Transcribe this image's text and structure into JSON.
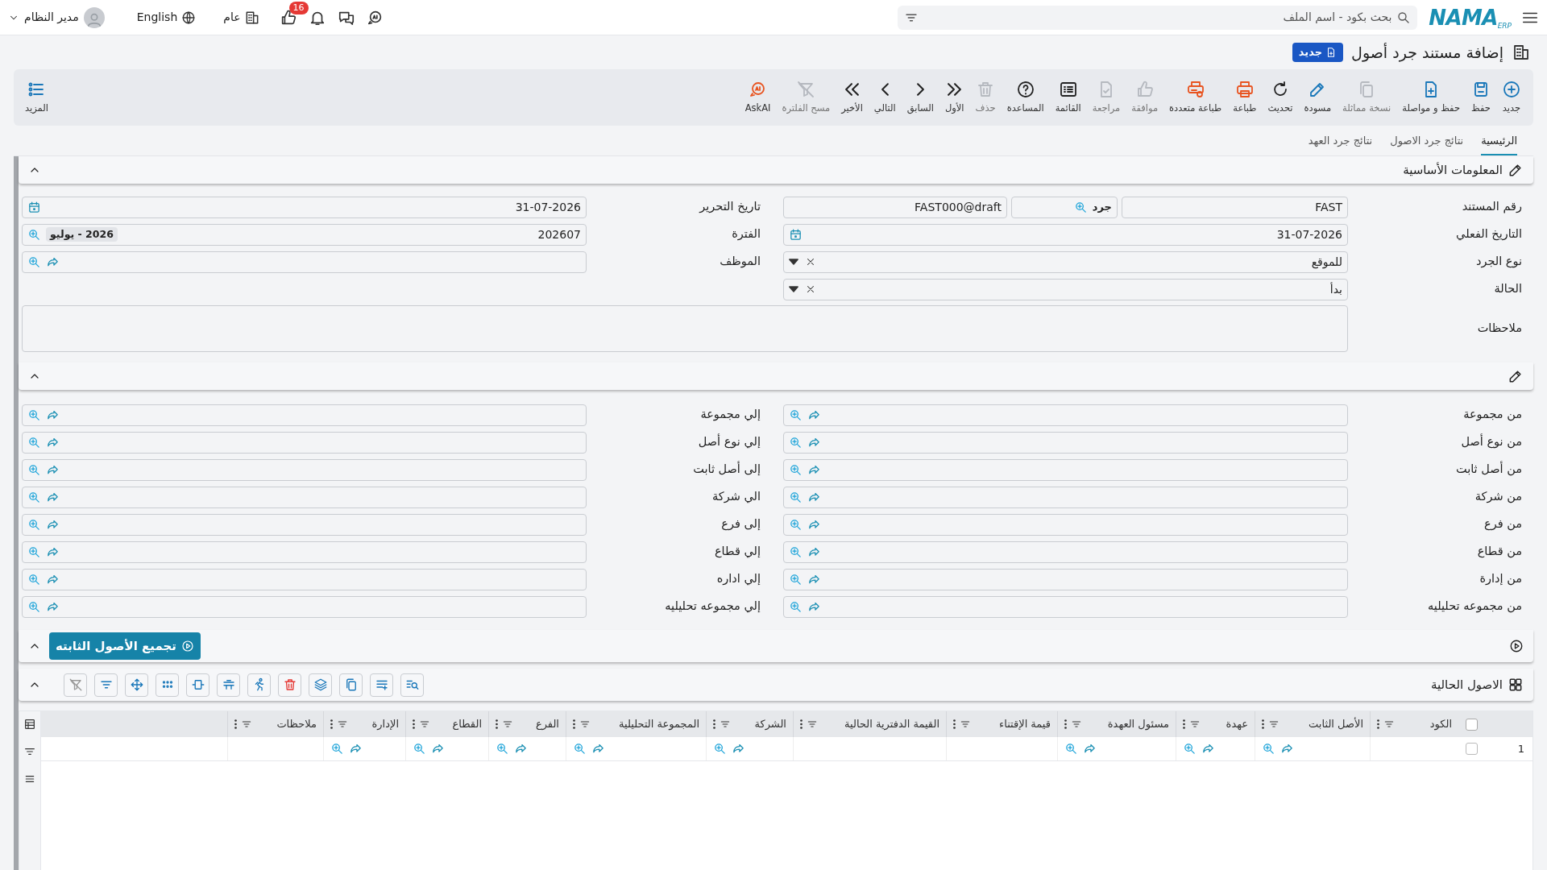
{
  "top_bar": {
    "logo": "NAMA",
    "logo_sub": "ERP",
    "search": {
      "placeholder": "بحث بكود - اسم الملف"
    },
    "user": "مدير النظام",
    "language": "English",
    "branch": "عام",
    "notifications_badge": "16"
  },
  "page": {
    "title": "إضافة مستند جرد أصول",
    "status_badge": "جديد"
  },
  "toolbar": [
    {
      "label": "جديد",
      "disabled": false
    },
    {
      "label": "حفظ",
      "disabled": false
    },
    {
      "label": "حفظ و مواصلة",
      "disabled": false
    },
    {
      "label": "نسخة مماثلة",
      "disabled": true
    },
    {
      "label": "مسودة",
      "disabled": false
    },
    {
      "label": "تحديث",
      "disabled": false
    },
    {
      "label": "طباعة",
      "disabled": false
    },
    {
      "label": "طباعة متعددة",
      "disabled": false
    },
    {
      "label": "موافقة",
      "disabled": true
    },
    {
      "label": "مراجعة",
      "disabled": true
    },
    {
      "label": "القائمة",
      "disabled": false
    },
    {
      "label": "المساعدة",
      "disabled": false
    },
    {
      "label": "حذف",
      "disabled": true
    },
    {
      "label": "الأول",
      "disabled": false
    },
    {
      "label": "السابق",
      "disabled": false
    },
    {
      "label": "التالي",
      "disabled": false
    },
    {
      "label": "الأخير",
      "disabled": false
    },
    {
      "label": "مسح الفلترة",
      "disabled": true
    },
    {
      "label": "AskAI",
      "disabled": false
    }
  ],
  "more_button": "المزيد",
  "tabs": [
    {
      "label": "الرئيسية",
      "selected": true
    },
    {
      "label": "نتائج جرد الاصول",
      "selected": false
    },
    {
      "label": "نتائج جرد العهد",
      "selected": false
    }
  ],
  "basic_info": {
    "title": "المعلومات الأساسية",
    "expanded": true,
    "fields": [
      {
        "kind": "document_number",
        "label": "رقم المستند",
        "value": "FAST",
        "tag": "جرد",
        "draft": "FAST000@draft"
      },
      {
        "kind": "date",
        "label": "تاريخ التحرير",
        "value": "31-07-2026"
      },
      {
        "kind": "date",
        "label": "التاريخ الفعلي",
        "value": "31-07-2026"
      },
      {
        "kind": "period",
        "label": "الفترة",
        "value": "202607",
        "chip": "2026 - يوليو"
      },
      {
        "kind": "select",
        "label": "نوع الجرد",
        "value": "للموقع"
      },
      {
        "kind": "lookup",
        "label": "الموظف"
      },
      {
        "kind": "select",
        "label": "الحالة",
        "value": "بدأ"
      }
    ],
    "notes_label": "ملاحظات"
  },
  "range_section": {
    "expanded": true,
    "fields": [
      {
        "label": "من مجموعة"
      },
      {
        "label": "إلي مجموعة"
      },
      {
        "label": "من نوع أصل"
      },
      {
        "label": "إلي نوع أصل"
      },
      {
        "label": "من أصل ثابت"
      },
      {
        "label": "إلى أصل ثابت"
      },
      {
        "label": "من شركة"
      },
      {
        "label": "الي شركة"
      },
      {
        "label": "من فرع"
      },
      {
        "label": "إلى فرع"
      },
      {
        "label": "من قطاع"
      },
      {
        "label": "إلي قطاع"
      },
      {
        "label": "من إدارة"
      },
      {
        "label": "إلي اداره"
      },
      {
        "label": "من مجموعه تحليليه"
      },
      {
        "label": "إلي مجموعه تحليليه"
      }
    ]
  },
  "collect_button": "تجميع الأصول الثابته",
  "assets_grid": {
    "title": "الاصول الحالية",
    "expanded": true,
    "select_all_checked": false,
    "columns": [
      "الكود",
      "الأصل الثابت",
      "عهدة",
      "مسئول العهدة",
      "قيمة الإقتناء",
      "القيمة الدفترية الحالية",
      "الشركة",
      "المجموعة التحليلية",
      "الفرع",
      "القطاع",
      "الإدارة",
      "ملاحظات"
    ],
    "rows": [
      {
        "number": "1",
        "checked": false,
        "cells": [
          {
            "kind": "empty"
          },
          {
            "kind": "lookup"
          },
          {
            "kind": "lookup"
          },
          {
            "kind": "lookup"
          },
          {
            "kind": "empty"
          },
          {
            "kind": "empty"
          },
          {
            "kind": "lookup"
          },
          {
            "kind": "lookup"
          },
          {
            "kind": "lookup"
          },
          {
            "kind": "lookup"
          },
          {
            "kind": "lookup"
          },
          {
            "kind": "empty"
          }
        ]
      }
    ]
  }
}
